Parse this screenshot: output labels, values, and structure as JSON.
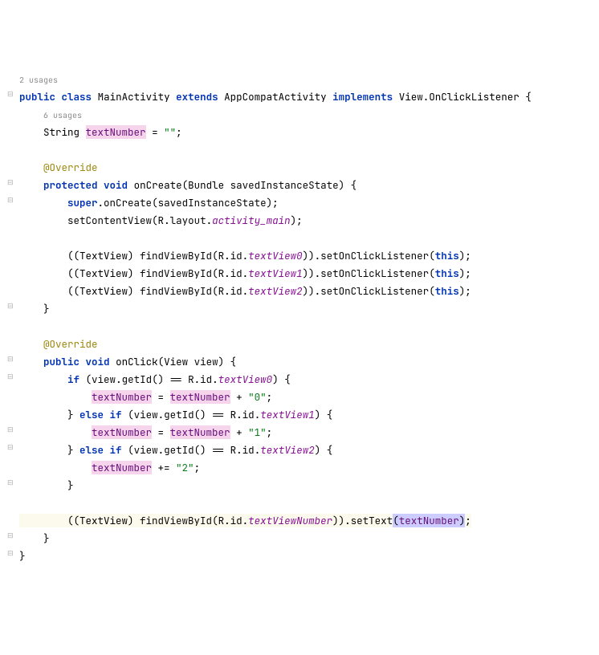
{
  "usages_top": "2 usages",
  "usages_field": "6 usages",
  "kw_public": "public",
  "kw_class": "class",
  "kw_extends": "extends",
  "kw_implements": "implements",
  "kw_protected": "protected",
  "kw_void": "void",
  "kw_super": "super",
  "kw_this": "this",
  "kw_if": "if",
  "kw_else": "else",
  "cls_MainActivity": "MainActivity",
  "cls_AppCompat": "AppCompatActivity",
  "cls_View": "View",
  "cls_OnClick": "OnClickListener",
  "cls_String": "String",
  "cls_Bundle": "Bundle",
  "cls_TextView": "TextView",
  "cls_R": "R",
  "ann_Override": "@Override",
  "field_textNumber": "textNumber",
  "m_onCreate": "onCreate",
  "m_onClick": "onClick",
  "m_saved": "savedInstanceState",
  "m_setContentView": "setContentView",
  "m_findViewById": "findViewById",
  "m_setOnClick": "setOnClickListener",
  "m_getId": "getId",
  "m_setText": "setText",
  "m_view": "view",
  "id_layout": "layout",
  "id_id": "id",
  "id_activity_main": "activity_main",
  "id_textView0": "textView0",
  "id_textView1": "textView1",
  "id_textView2": "textView2",
  "id_textViewNumber": "textViewNumber",
  "str_empty": "\"\"",
  "str_0": "\"0\"",
  "str_1": "\"1\"",
  "str_2": "\"2\""
}
